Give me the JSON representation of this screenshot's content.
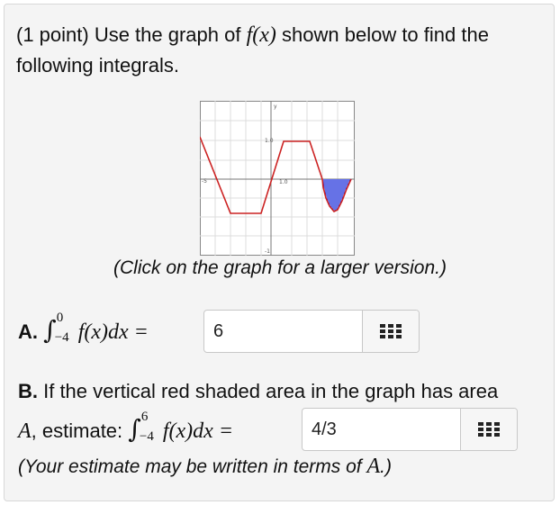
{
  "question": {
    "prefix": "(1 point) Use the graph of ",
    "f_of_x": "f(x)",
    "suffix": " shown below to find the following integrals."
  },
  "graph": {
    "y_top_label": "1.0",
    "y_bottom_label": "-1",
    "x_left_label": "-5",
    "x_mid_label": "1.0",
    "curve_color": "#cc2222",
    "shade_color": "#2233dd"
  },
  "graph_caption": "(Click on the graph for a larger version.)",
  "partA": {
    "letter": "A.",
    "integral_upper": "0",
    "integral_lower": "−4",
    "integrand": "f(x)dx =",
    "answer_value": "6",
    "keypad_icon": "grid-keypad-icon"
  },
  "partB": {
    "letter": "B.",
    "text1": " If the vertical red shaded area in the graph has area",
    "var_A": "A",
    "text2": ", estimate: ",
    "integral_upper": "6",
    "integral_lower": "−4",
    "integrand": "f(x)dx =",
    "answer_value": "4/3",
    "keypad_icon": "grid-keypad-icon"
  },
  "note": {
    "text": "(Your estimate may be written in terms of ",
    "var_A": "A",
    "close": ".)"
  }
}
